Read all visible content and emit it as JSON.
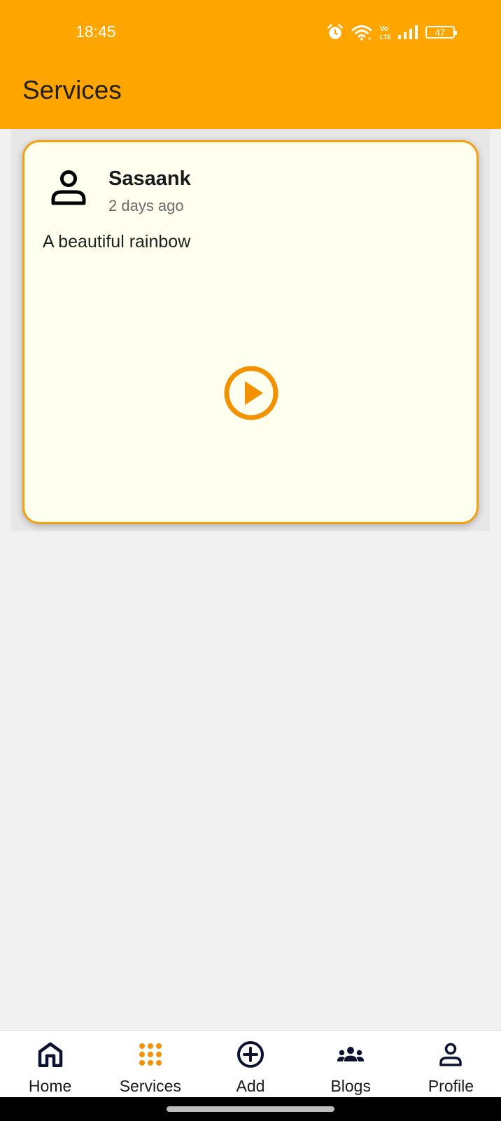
{
  "status_bar": {
    "time": "18:45",
    "battery": "47",
    "icons": [
      "alarm-icon",
      "wifi-icon",
      "volte-icon",
      "signal-icon",
      "battery-icon"
    ]
  },
  "header": {
    "title": "Services",
    "background_color": "#ffa500"
  },
  "posts": [
    {
      "author": "Sasaank",
      "time": "2 days ago",
      "caption": "A beautiful rainbow",
      "media": "play-icon",
      "border_color": "#f5a012",
      "background_color": "#fffff0"
    }
  ],
  "bottom_nav": {
    "active": "Services",
    "active_color": "#f39200",
    "items": [
      {
        "label": "Home",
        "icon": "home-icon"
      },
      {
        "label": "Services",
        "icon": "grid-dots-icon"
      },
      {
        "label": "Add",
        "icon": "add-circle-icon"
      },
      {
        "label": "Blogs",
        "icon": "group-icon"
      },
      {
        "label": "Profile",
        "icon": "person-icon"
      }
    ]
  }
}
